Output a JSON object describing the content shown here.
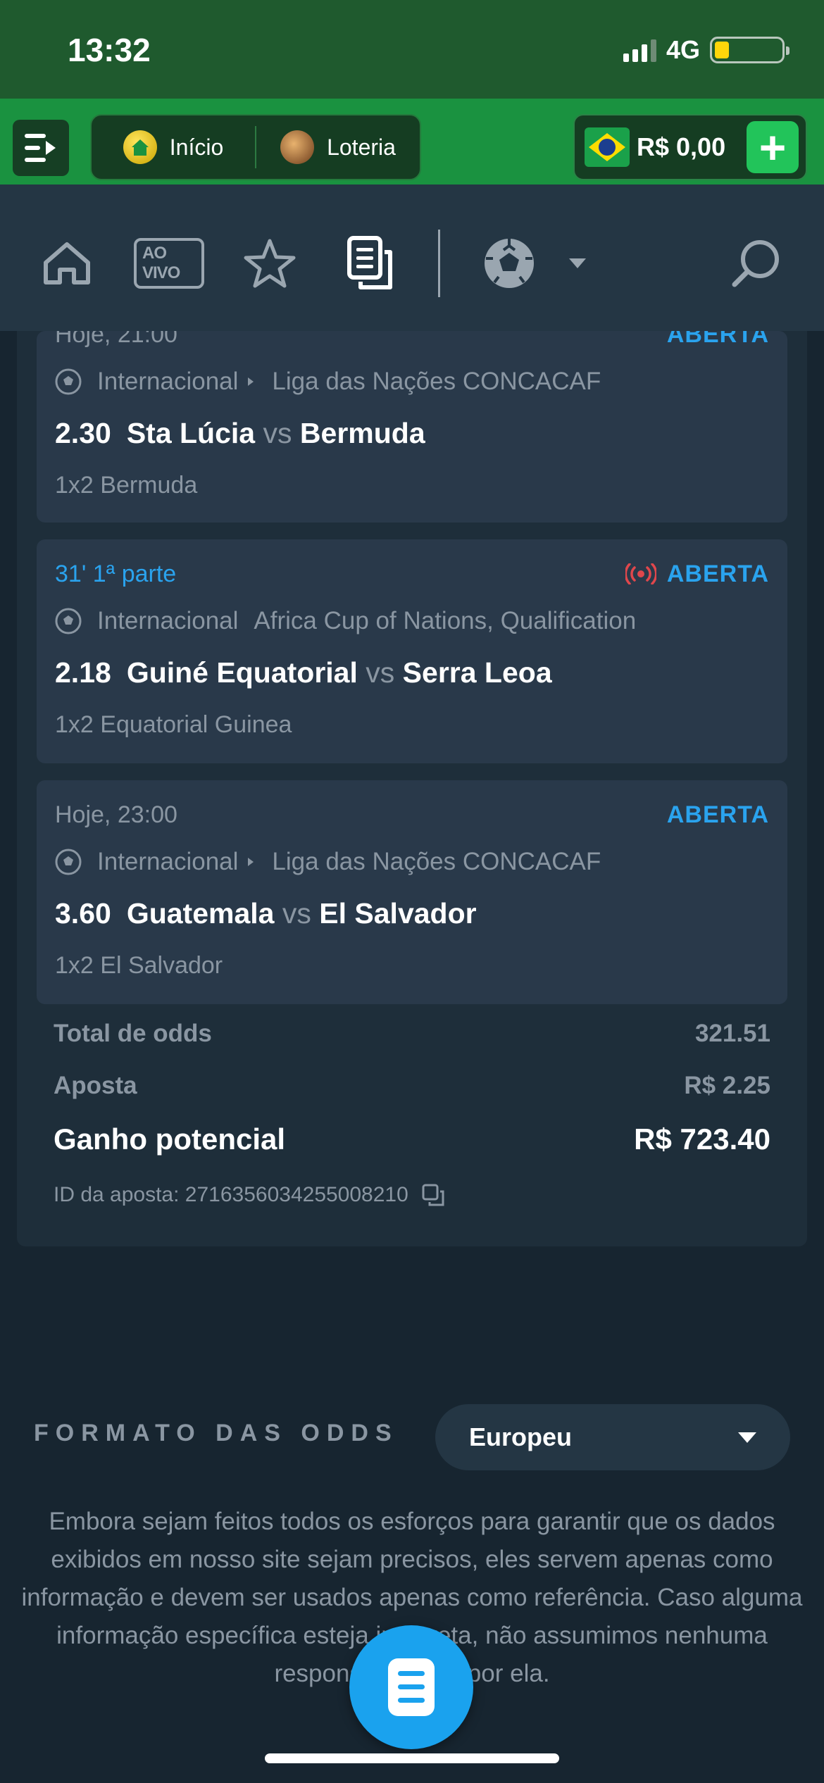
{
  "status_bar": {
    "time": "13:32",
    "network": "4G"
  },
  "header": {
    "menu_icon": "menu-icon",
    "nav": [
      {
        "label": "Início",
        "icon": "home-icon"
      },
      {
        "label": "Loteria",
        "icon": "lottery-icon"
      }
    ],
    "balance": "R$ 0,00",
    "currency_flag": "brazil-flag-icon",
    "deposit_icon": "plus-icon"
  },
  "toolbar": {
    "items": [
      "home-icon",
      "ao-vivo-icon",
      "favorites-star-icon",
      "bet-slip-icon",
      "soccer-ball-icon",
      "dropdown-icon",
      "search-icon"
    ],
    "ao_vivo_label": "AO VIVO"
  },
  "bets": [
    {
      "time": "Hoje, 21:00",
      "live": false,
      "status": "ABERTA",
      "league_country": "Internacional",
      "league_name": "Liga das Nações CONCACAF",
      "odds": "2.30",
      "home": "Sta Lúcia",
      "vs": "vs",
      "away": "Bermuda",
      "market": "1x2 Bermuda"
    },
    {
      "time": "31' 1ª parte",
      "live": true,
      "status": "ABERTA",
      "league_country": "Internacional",
      "league_name": "Africa Cup of Nations, Qualification",
      "odds": "2.18",
      "home": "Guiné Equatorial",
      "vs": "vs",
      "away": "Serra Leoa",
      "market": "1x2 Equatorial Guinea"
    },
    {
      "time": "Hoje, 23:00",
      "live": false,
      "status": "ABERTA",
      "league_country": "Internacional",
      "league_name": "Liga das Nações CONCACAF",
      "odds": "3.60",
      "home": "Guatemala",
      "vs": "vs",
      "away": "El Salvador",
      "market": "1x2 El Salvador"
    }
  ],
  "summary": {
    "total_odds_label": "Total de odds",
    "total_odds_value": "321.51",
    "stake_label": "Aposta",
    "stake_value": "R$ 2.25",
    "potential_label": "Ganho potencial",
    "potential_value": "R$ 723.40",
    "bet_id_label": "ID da aposta: 2716356034255008210"
  },
  "odds_format": {
    "label": "FORMATO DAS ODDS",
    "selected": "Europeu"
  },
  "disclaimer": "Embora sejam feitos todos os esforços para garantir que os dados exibidos em nosso site sejam precisos, eles servem apenas como informação e devem ser usados apenas como referência. Caso alguma informação específica esteja incorreta, não assumimos nenhuma responsabilidade por ela.",
  "colors": {
    "brand_green": "#1a9240",
    "accent_blue": "#2aa3ee",
    "live_red": "#e0474c",
    "background": "#172530"
  }
}
